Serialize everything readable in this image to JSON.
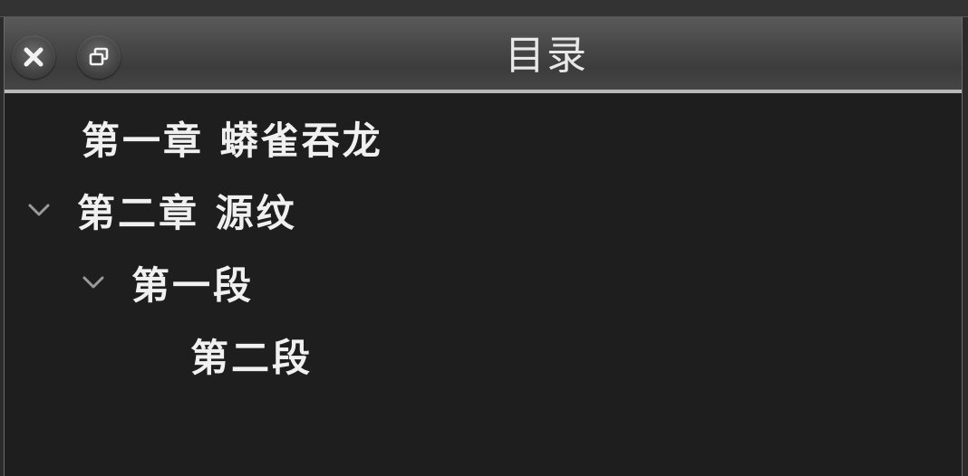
{
  "panel": {
    "title": "目录"
  },
  "tree": {
    "items": [
      {
        "label": "第一章 蟒雀吞龙",
        "expanded": false
      },
      {
        "label": "第二章 源纹",
        "expanded": true
      },
      {
        "label": "第一段",
        "expanded": true
      },
      {
        "label": "第二段",
        "expanded": false
      }
    ]
  },
  "icons": {
    "close": "close-icon",
    "restore": "restore-icon",
    "chevron": "chevron-down-icon"
  }
}
